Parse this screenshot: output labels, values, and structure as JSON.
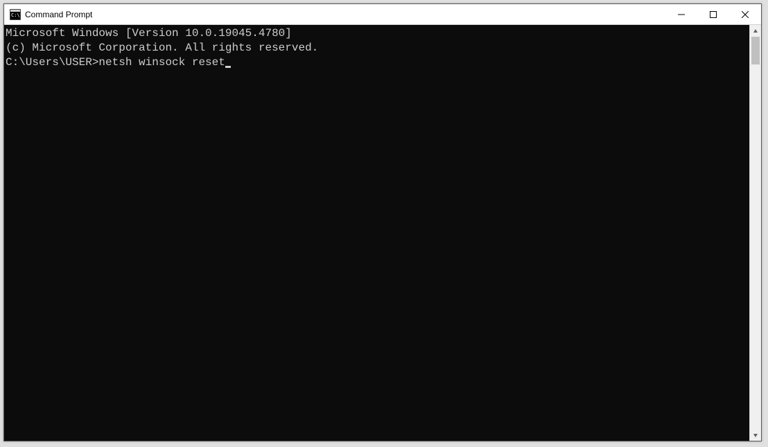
{
  "window": {
    "title": "Command Prompt"
  },
  "terminal": {
    "line1": "Microsoft Windows [Version 10.0.19045.4780]",
    "line2": "(c) Microsoft Corporation. All rights reserved.",
    "blank": "",
    "prompt": "C:\\Users\\USER>",
    "command": "netsh winsock reset"
  }
}
